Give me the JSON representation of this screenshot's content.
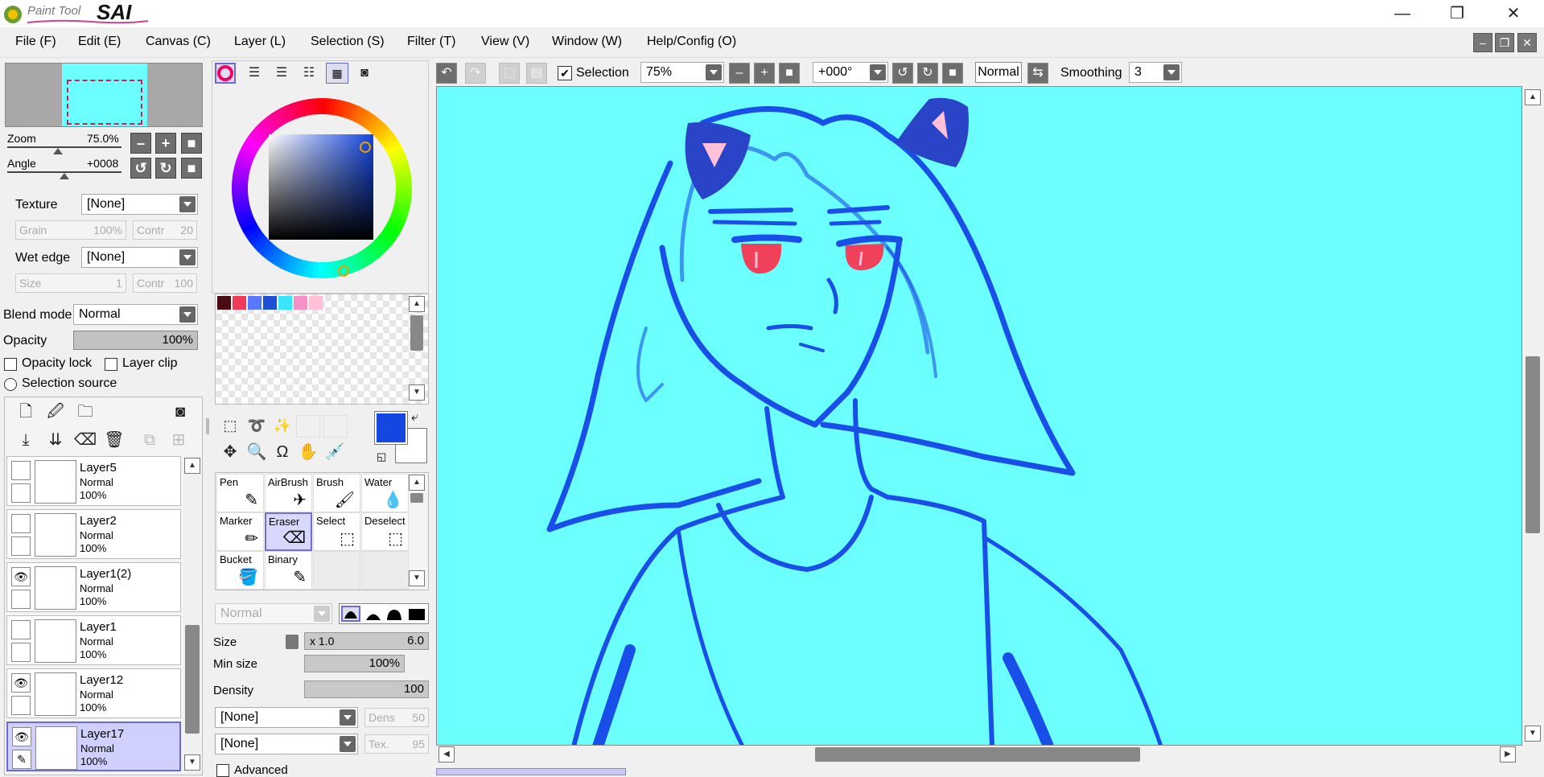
{
  "app": {
    "logo_small": "Paint Tool",
    "logo_big": "SAI"
  },
  "window_controls": {
    "minimize": "—",
    "restore": "❐",
    "close": "✕"
  },
  "menu": [
    "File (F)",
    "Edit (E)",
    "Canvas (C)",
    "Layer (L)",
    "Selection (S)",
    "Filter (T)",
    "View (V)",
    "Window (W)",
    "Help/Config (O)"
  ],
  "navigator": {
    "zoom_label": "Zoom",
    "zoom_value": "75.0%",
    "angle_label": "Angle",
    "angle_value": "+0008"
  },
  "brush_settings": {
    "texture_label": "Texture",
    "texture_value": "[None]",
    "grain_label": "Grain",
    "grain_value": "100%",
    "contr1_label": "Contr",
    "contr1_value": "20",
    "wet_edge_label": "Wet edge",
    "wet_edge_value": "[None]",
    "size_label": "Size",
    "size_value": "1",
    "contr2_label": "Contr",
    "contr2_value": "100"
  },
  "layer_settings": {
    "blend_label": "Blend mode",
    "blend_value": "Normal",
    "opacity_label": "Opacity",
    "opacity_value": "100%",
    "opacity_fraction": 1.0,
    "opacity_lock": "Opacity lock",
    "layer_clip": "Layer clip",
    "selection_source": "Selection source"
  },
  "layers": [
    {
      "name": "Layer5",
      "mode": "Normal",
      "opacity": "100%",
      "visible": false,
      "selected": false
    },
    {
      "name": "Layer2",
      "mode": "Normal",
      "opacity": "100%",
      "visible": false,
      "selected": false
    },
    {
      "name": "Layer1(2)",
      "mode": "Normal",
      "opacity": "100%",
      "visible": true,
      "selected": false
    },
    {
      "name": "Layer1",
      "mode": "Normal",
      "opacity": "100%",
      "visible": false,
      "selected": false
    },
    {
      "name": "Layer12",
      "mode": "Normal",
      "opacity": "100%",
      "visible": true,
      "selected": false
    },
    {
      "name": "Layer17",
      "mode": "Normal",
      "opacity": "100%",
      "visible": true,
      "selected": true
    }
  ],
  "swatches": [
    "#4a0b12",
    "#f03c5a",
    "#5a78ff",
    "#1e4fd8",
    "#3ae6ff",
    "#f78fc8",
    "#ffc0d8"
  ],
  "colors": {
    "primary": "#1446e0",
    "secondary": "#ffffff",
    "canvas_bg": "#6cffff",
    "line": "#1a4ee8"
  },
  "tools": [
    {
      "name": "Pen",
      "glyph": "✎"
    },
    {
      "name": "AirBrush",
      "glyph": "✈"
    },
    {
      "name": "Brush",
      "glyph": "🖌"
    },
    {
      "name": "Water",
      "glyph": "💧"
    },
    {
      "name": "Marker",
      "glyph": "✏"
    },
    {
      "name": "Eraser",
      "glyph": "⌫"
    },
    {
      "name": "Select",
      "glyph": "⬚"
    },
    {
      "name": "Deselect",
      "glyph": "⬚"
    },
    {
      "name": "Bucket",
      "glyph": "🪣"
    },
    {
      "name": "Binary",
      "glyph": "✎"
    }
  ],
  "tool_options": {
    "mode_value": "Normal",
    "size_label": "Size",
    "size_mult": "x 1.0",
    "size_value": "6.0",
    "min_size_label": "Min size",
    "min_size_value": "100%",
    "density_label": "Density",
    "density_value": "100",
    "texture1_value": "[None]",
    "dens_label": "Dens",
    "dens_value": "50",
    "texture2_value": "[None]",
    "tex_label": "Tex.",
    "tex_value": "95",
    "advanced_label": "Advanced"
  },
  "canvas_toolbar": {
    "selection_label": "Selection",
    "zoom_value": "75%",
    "angle_value": "+000°",
    "blend_value": "Normal",
    "smoothing_label": "Smoothing",
    "smoothing_value": "3"
  }
}
